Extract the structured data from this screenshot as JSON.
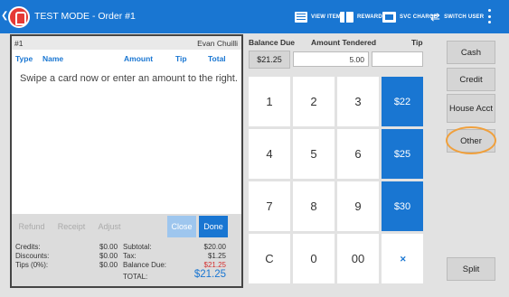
{
  "header": {
    "title": "TEST MODE - Order #1",
    "view_items": "VIEW ITEMS",
    "rewards": "REWARDS",
    "svc_charge": "SVC CHARGE",
    "switch_user": "SWITCH USER"
  },
  "order": {
    "number": "#1",
    "customer": "Evan Chuilli",
    "columns": [
      "Type",
      "Name",
      "Amount",
      "Tip",
      "Total"
    ],
    "prompt": "Swipe a card now or enter an amount to the right."
  },
  "actions": {
    "refund": "Refund",
    "receipt": "Receipt",
    "adjust": "Adjust",
    "close": "Close",
    "done": "Done"
  },
  "summary": {
    "credits_label": "Credits:",
    "credits_value": "$0.00",
    "discounts_label": "Discounts:",
    "discounts_value": "$0.00",
    "tips_label": "Tips (0%):",
    "tips_value": "$0.00",
    "subtotal_label": "Subtotal:",
    "subtotal_value": "$20.00",
    "tax_label": "Tax:",
    "tax_value": "$1.25",
    "balance_due_label": "Balance Due:",
    "balance_due_value": "$21.25",
    "total_label": "TOTAL:",
    "total_value": "$21.25"
  },
  "amounts": {
    "balance_due_header": "Balance Due",
    "amount_tendered_header": "Amount Tendered",
    "tip_header": "Tip",
    "balance_due_value": "$21.25",
    "amount_tendered_value": "5.00",
    "tip_value": ""
  },
  "keypad": {
    "k1": "1",
    "k2": "2",
    "k3": "3",
    "k4": "4",
    "k5": "5",
    "k6": "6",
    "k7": "7",
    "k8": "8",
    "k9": "9",
    "kc": "C",
    "k0": "0",
    "k00": "00",
    "quick1": "$22",
    "quick2": "$25",
    "quick3": "$30"
  },
  "payment_methods": {
    "cash": "Cash",
    "credit": "Credit",
    "house_acct": "House Acct",
    "other": "Other",
    "split": "Split"
  },
  "colors": {
    "accent": "#1976d2",
    "logo": "#e53935",
    "highlight_ring": "#f0a03c",
    "due_red": "#d32f2f"
  }
}
